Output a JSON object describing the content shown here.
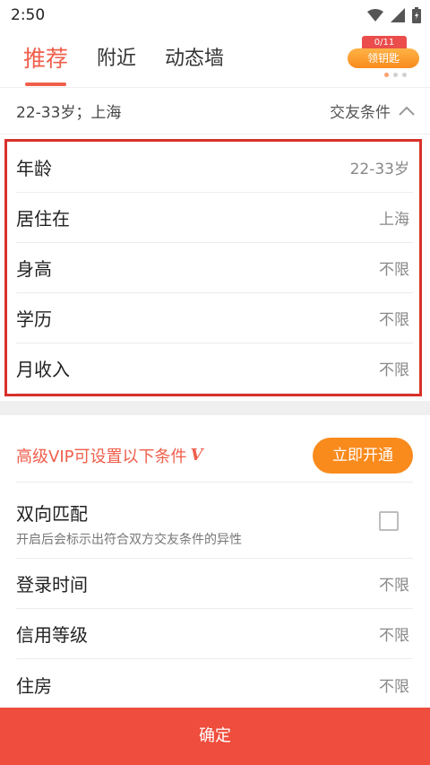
{
  "status_bar": {
    "time": "2:50",
    "icons": [
      "wifi-icon",
      "signal-icon",
      "battery-icon"
    ]
  },
  "tabs": [
    {
      "label": "推荐",
      "active": true
    },
    {
      "label": "附近",
      "active": false
    },
    {
      "label": "动态墙",
      "active": false
    }
  ],
  "promo": {
    "count": "0/11",
    "label": "领钥匙"
  },
  "summary": {
    "text": "22-33岁；上海",
    "toggle_label": "交友条件"
  },
  "basic_filters": [
    {
      "label": "年龄",
      "value": "22-33岁"
    },
    {
      "label": "居住在",
      "value": "上海"
    },
    {
      "label": "身高",
      "value": "不限"
    },
    {
      "label": "学历",
      "value": "不限"
    },
    {
      "label": "月收入",
      "value": "不限"
    }
  ],
  "vip": {
    "title": "高级VIP可设置以下条件",
    "badge": "V",
    "button_label": "立即开通"
  },
  "match": {
    "title": "双向匹配",
    "description": "开启后会标示出符合双方交友条件的异性",
    "checked": false
  },
  "vip_filters": [
    {
      "label": "登录时间",
      "value": "不限"
    },
    {
      "label": "信用等级",
      "value": "不限"
    },
    {
      "label": "住房",
      "value": "不限"
    }
  ],
  "footer": {
    "confirm_label": "确定"
  },
  "colors": {
    "accent": "#ef5e4b",
    "orange": "#f98a1c",
    "highlight_border": "#d9302a",
    "footer": "#ef4d3d"
  }
}
